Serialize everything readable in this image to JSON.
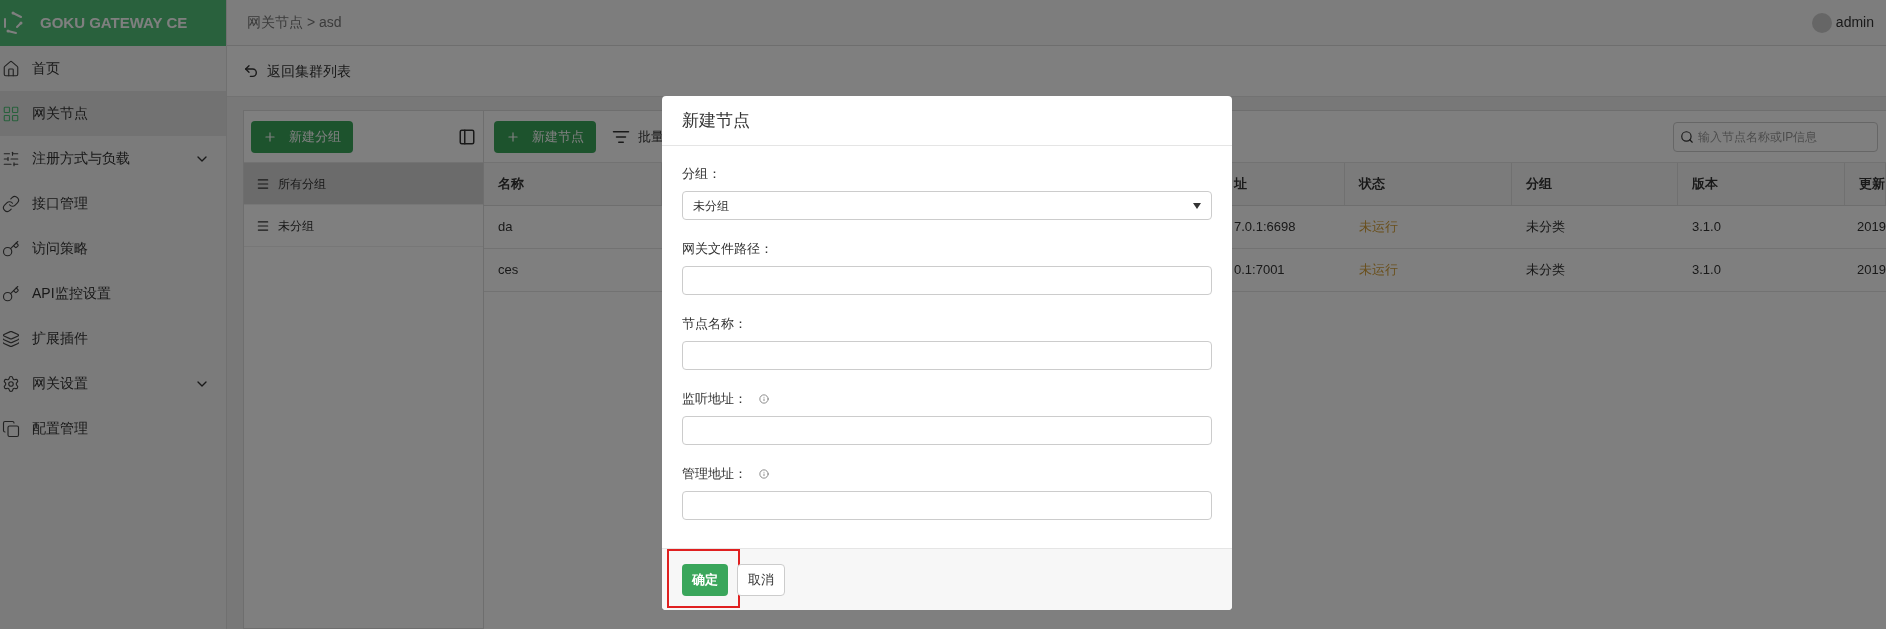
{
  "brand": {
    "name": "GOKU GATEWAY CE"
  },
  "breadcrumb": "网关节点 > asd",
  "user": {
    "name": "admin"
  },
  "sidebar": {
    "items": [
      {
        "label": "首页",
        "selected": false,
        "expandable": false
      },
      {
        "label": "网关节点",
        "selected": true,
        "expandable": false
      },
      {
        "label": "注册方式与负载",
        "selected": false,
        "expandable": true
      },
      {
        "label": "接口管理",
        "selected": false,
        "expandable": false
      },
      {
        "label": "访问策略",
        "selected": false,
        "expandable": false
      },
      {
        "label": "API监控设置",
        "selected": false,
        "expandable": false
      },
      {
        "label": "扩展插件",
        "selected": false,
        "expandable": false
      },
      {
        "label": "网关设置",
        "selected": false,
        "expandable": true
      },
      {
        "label": "配置管理",
        "selected": false,
        "expandable": false
      }
    ]
  },
  "back_link": "返回集群列表",
  "groups": {
    "new_button": "新建分组",
    "items": [
      {
        "label": "所有分组",
        "selected": true
      },
      {
        "label": "未分组",
        "selected": false
      }
    ]
  },
  "nodes": {
    "new_button": "新建节点",
    "batch_button": "批量",
    "search": {
      "placeholder": "输入节点名称或IP信息"
    },
    "table": {
      "columns": [
        {
          "label": "名称"
        },
        {
          "label": "址"
        },
        {
          "label": "状态"
        },
        {
          "label": "分组"
        },
        {
          "label": "版本"
        },
        {
          "label": "更新"
        }
      ],
      "rows": [
        {
          "name": "da",
          "address": "7.0.1:6698",
          "status": "未运行",
          "running": false,
          "group": "未分类",
          "version": "3.1.0",
          "updated": "2019"
        },
        {
          "name": "ces",
          "address": "0.1:7001",
          "status": "未运行",
          "running": false,
          "group": "未分类",
          "version": "3.1.0",
          "updated": "2019"
        }
      ]
    }
  },
  "modal": {
    "title": "新建节点",
    "fields": [
      {
        "kind": "select",
        "label": "分组：",
        "value": "未分组",
        "info": false
      },
      {
        "kind": "text",
        "label": "网关文件路径：",
        "info": false
      },
      {
        "kind": "text",
        "label": "节点名称：",
        "info": false
      },
      {
        "kind": "text",
        "label": "监听地址：",
        "info": true
      },
      {
        "kind": "text",
        "label": "管理地址：",
        "info": true
      }
    ],
    "buttons": [
      {
        "label": "确定",
        "kind": "primary",
        "highlighted": true
      },
      {
        "label": "取消",
        "kind": "default",
        "highlighted": false
      }
    ]
  }
}
